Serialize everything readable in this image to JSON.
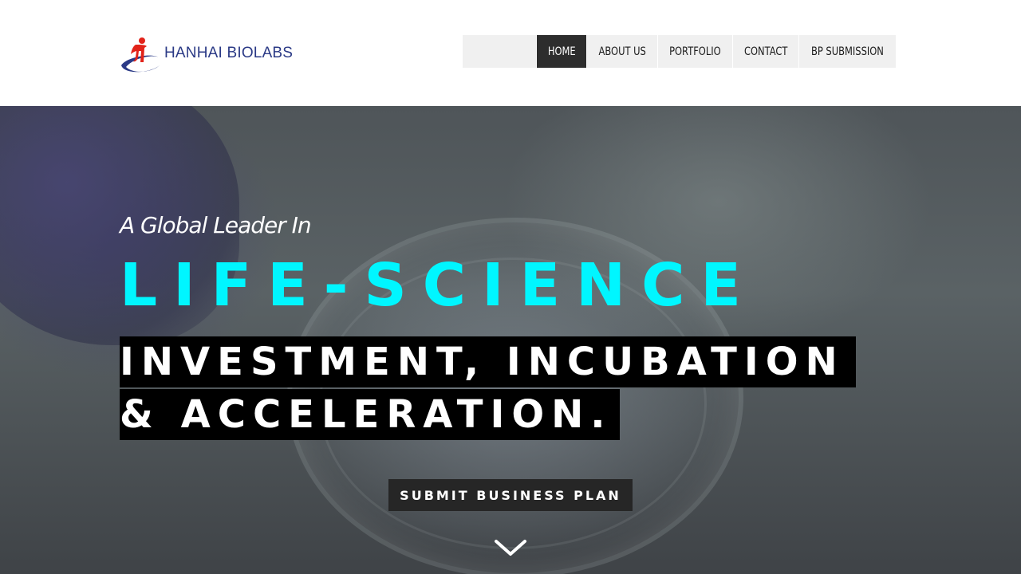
{
  "brand": {
    "name": "HANHAI BIOLABS",
    "colors": {
      "logo_red": "#e2231a",
      "logo_blue": "#2b3a86",
      "accent_cyan": "#00f6ff",
      "nav_active_bg": "#2d2d2d",
      "nav_bg": "#f0f0f0"
    }
  },
  "nav": {
    "items": [
      {
        "label": "HOME",
        "active": true
      },
      {
        "label": "ABOUT US",
        "active": false
      },
      {
        "label": "PORTFOLIO",
        "active": false
      },
      {
        "label": "CONTACT",
        "active": false
      },
      {
        "label": "BP SUBMISSION",
        "active": false
      }
    ]
  },
  "hero": {
    "subtitle": "A Global Leader In",
    "headline": "LIFE-SCIENCE",
    "line1": "INVESTMENT, INCUBATION",
    "line2": "& ACCELERATION.",
    "cta_label": "SUBMIT BUSINESS PLAN",
    "scroll_icon": "chevron-down-icon"
  }
}
